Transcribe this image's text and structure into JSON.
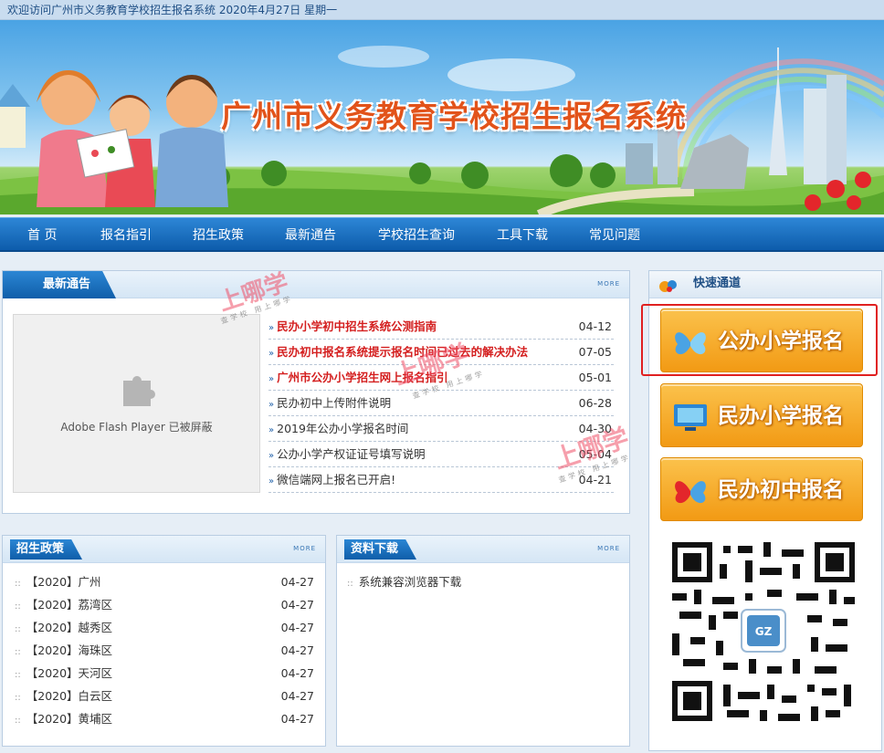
{
  "topbar": {
    "welcome": "欢迎访问广州市义务教育学校招生报名系统 2020年4月27日 星期一"
  },
  "banner": {
    "title": "广州市义务教育学校招生报名系统"
  },
  "nav": {
    "items": [
      "首 页",
      "报名指引",
      "招生政策",
      "最新通告",
      "学校招生查询",
      "工具下载",
      "常见问题"
    ]
  },
  "news": {
    "title": "最新通告",
    "more": "MORE",
    "flash_message": "Adobe Flash Player 已被屏蔽",
    "items": [
      {
        "text": "民办小学初中招生系统公测指南",
        "date": "04-12",
        "hot": true
      },
      {
        "text": "民办初中报名系统提示报名时间已过去的解决办法",
        "date": "07-05",
        "hot": true
      },
      {
        "text": "广州市公办小学招生网上报名指引",
        "date": "05-01",
        "hot": true
      },
      {
        "text": "民办初中上传附件说明",
        "date": "06-28",
        "hot": false
      },
      {
        "text": "2019年公办小学报名时间",
        "date": "04-30",
        "hot": false
      },
      {
        "text": "公办小学产权证证号填写说明",
        "date": "05-04",
        "hot": false
      },
      {
        "text": "微信端网上报名已开启!",
        "date": "04-21",
        "hot": false
      }
    ]
  },
  "policy": {
    "title": "招生政策",
    "more": "MORE",
    "items": [
      {
        "text": "【2020】广州",
        "date": "04-27"
      },
      {
        "text": "【2020】荔湾区",
        "date": "04-27"
      },
      {
        "text": "【2020】越秀区",
        "date": "04-27"
      },
      {
        "text": "【2020】海珠区",
        "date": "04-27"
      },
      {
        "text": "【2020】天河区",
        "date": "04-27"
      },
      {
        "text": "【2020】白云区",
        "date": "04-27"
      },
      {
        "text": "【2020】黄埔区",
        "date": "04-27"
      }
    ]
  },
  "downloads": {
    "title": "资料下载",
    "more": "MORE",
    "items": [
      {
        "text": "系统兼容浏览器下载"
      }
    ]
  },
  "quick": {
    "title": "快速通道",
    "buttons": [
      {
        "label": "公办小学报名",
        "icon": "butterfly-icon",
        "highlighted": true
      },
      {
        "label": "民办小学报名",
        "icon": "monitor-icon",
        "highlighted": false
      },
      {
        "label": "民办初中报名",
        "icon": "butterfly-icon",
        "highlighted": false
      }
    ],
    "qr_badge": "GZ",
    "highlight_color": "#e02020"
  },
  "watermark": {
    "brand": "上哪学",
    "tagline": "查学校 用上哪学"
  }
}
